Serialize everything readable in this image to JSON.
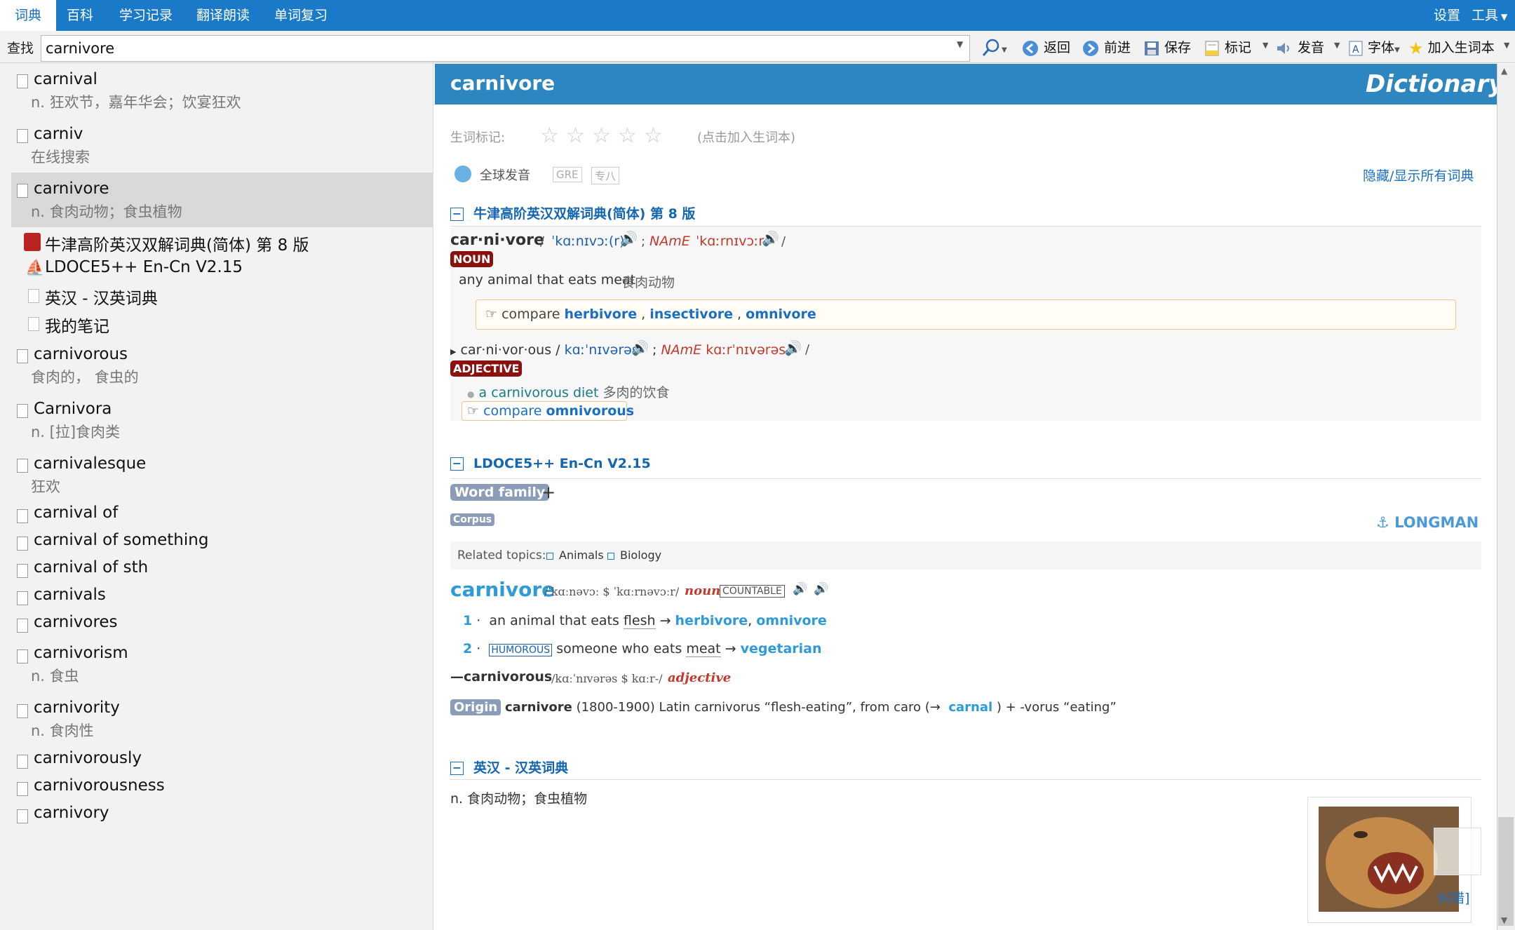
{
  "tabs": [
    "词典",
    "百科",
    "学习记录",
    "翻译朗读",
    "单词复习"
  ],
  "top_right": {
    "settings": "设置",
    "tools": "工具"
  },
  "search": {
    "label": "查找",
    "value": "carnivore"
  },
  "toolbar": {
    "back": "返回",
    "forward": "前进",
    "save": "保存",
    "mark": "标记",
    "speak": "发音",
    "font": "字体",
    "add_vocab": "加入生词本"
  },
  "list": [
    {
      "word": "carnival",
      "def": "n. 狂欢节，嘉年华会；饮宴狂欢"
    },
    {
      "word": "carniv",
      "def": "在线搜索"
    },
    {
      "word": "carnivore",
      "def": "n. 食肉动物；食虫植物"
    },
    {
      "word": "carnivorous",
      "def": "食肉的， 食虫的"
    },
    {
      "word": "Carnivora",
      "def": "n. [拉]食肉类"
    },
    {
      "word": "carnivalesque",
      "def": "狂欢"
    },
    {
      "word": "carnival of",
      "def": ""
    },
    {
      "word": "carnival of something",
      "def": ""
    },
    {
      "word": "carnival of sth",
      "def": ""
    },
    {
      "word": "carnivals",
      "def": ""
    },
    {
      "word": "carnivores",
      "def": ""
    },
    {
      "word": "carnivorism",
      "def": "n. 食虫"
    },
    {
      "word": "carnivority",
      "def": "n. 食肉性"
    },
    {
      "word": "carnivorously",
      "def": ""
    },
    {
      "word": "carnivorousness",
      "def": ""
    },
    {
      "word": "carnivory",
      "def": ""
    }
  ],
  "dicts": [
    "牛津高阶英汉双解词典(简体) 第 8 版",
    "LDOCE5++ En-Cn V2.15",
    "英汉 - 汉英词典",
    "我的笔记"
  ],
  "entry": {
    "word": "carnivore",
    "brand": "Dictionary"
  },
  "vocab": {
    "label": "生词标记:",
    "hint": "(点击加入生词本)"
  },
  "pron": {
    "global": "全球发音",
    "tag1": "GRE",
    "tag2": "专八",
    "toggle": "隐藏/显示所有词典"
  },
  "oxford": {
    "title": "牛津高阶英汉双解词典(简体) 第 8 版",
    "hw": "car·ni·vore",
    "br": "ˈkɑːnɪvɔː(r)",
    "name": "NAmE",
    "am": "ˈkɑːrnɪvɔːr",
    "pos": "NOUN",
    "def_en": "any animal that eats meat",
    "def_zh": "食肉动物",
    "compare": "compare",
    "c1": "herbivore",
    "c2": "insectivore",
    "c3": "omnivore",
    "der": "car·ni·vor·ous",
    "der_br": "kɑːˈnɪvərəs",
    "der_am": "kɑːrˈnɪvərəs",
    "pos2": "ADJECTIVE",
    "ex_en": "a carnivorous diet",
    "ex_zh": "多肉的饮食",
    "compare2": "omnivorous"
  },
  "ldoce": {
    "title": "LDOCE5++ En-Cn V2.15",
    "word_family": "Word family",
    "plus": "+",
    "corpus": "Corpus",
    "longman": "LONGMAN",
    "topics_label": "Related topics:",
    "topic1": "Animals",
    "topic2": "Biology",
    "hw": "carnivore",
    "pron": "/ˈkɑːnəvɔː $ ˈkɑːrnəvɔːr/",
    "pos": "noun",
    "gram": "COUNTABLE",
    "s1_num": "1",
    "s1_text": "an animal that eats",
    "s1_key": "flesh",
    "s1_x1": "herbivore",
    "s1_x2": "omnivore",
    "s2_num": "2",
    "s2_reg": "HUMOROUS",
    "s2_text": "someone who eats",
    "s2_key": "meat",
    "s2_x": "vegetarian",
    "rd": "—carnivorous",
    "rd_pron": "/kɑːˈnɪvərəs $ kɑːr-/",
    "rd_pos": "adjective",
    "origin_label": "Origin",
    "origin_word": "carnivore",
    "origin_text1": "(1800-1900) Latin carnivorus “flesh-eating”, from caro (→",
    "origin_link": "carnal",
    "origin_text2": ") + -vorus “eating”"
  },
  "ec": {
    "title": "英汉 - 汉英词典",
    "def": "n. 食肉动物；食虫植物"
  },
  "image": {
    "caption": "纠错]"
  }
}
